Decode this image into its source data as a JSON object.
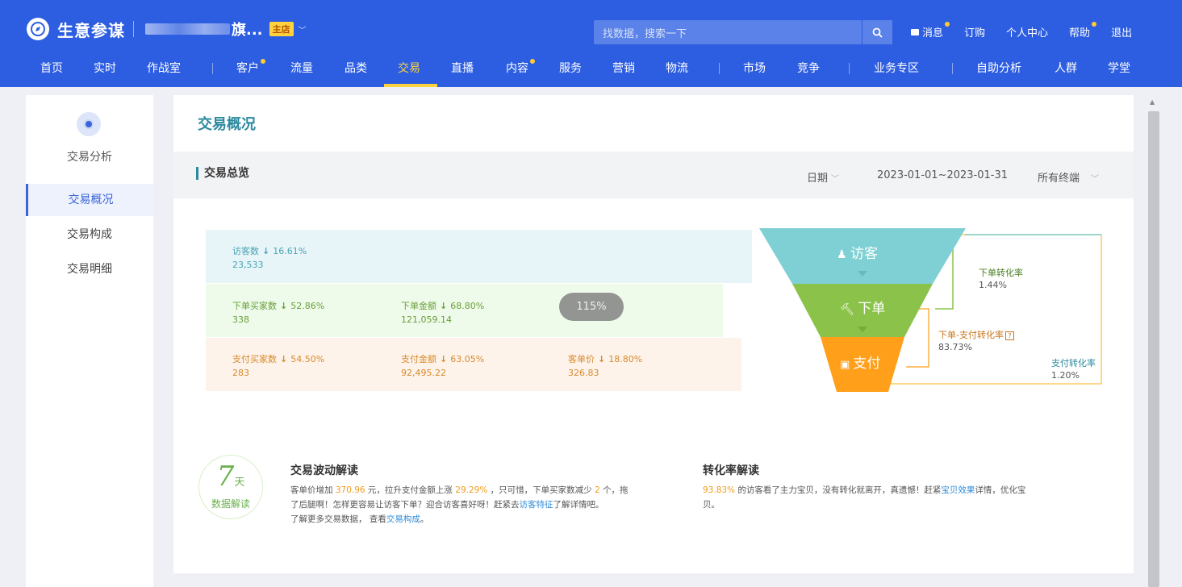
{
  "header": {
    "app_name": "生意参谋",
    "shop_name": "旗...",
    "shop_badge": "主店",
    "search_placeholder": "找数据，搜索一下",
    "links": [
      {
        "label": "消息",
        "dot": true
      },
      {
        "label": "订购",
        "dot": false
      },
      {
        "label": "个人中心",
        "dot": false
      },
      {
        "label": "帮助",
        "dot": true
      },
      {
        "label": "退出",
        "dot": false
      }
    ],
    "nav": [
      {
        "label": "首页",
        "dot": false
      },
      {
        "label": "实时",
        "dot": false
      },
      {
        "label": "作战室",
        "dot": false
      },
      {
        "label": "客户",
        "dot": true
      },
      {
        "label": "流量",
        "dot": false
      },
      {
        "label": "品类",
        "dot": false
      },
      {
        "label": "交易",
        "dot": false,
        "active": true
      },
      {
        "label": "直播",
        "dot": false
      },
      {
        "label": "内容",
        "dot": true
      },
      {
        "label": "服务",
        "dot": false
      },
      {
        "label": "营销",
        "dot": false
      },
      {
        "label": "物流",
        "dot": false
      },
      {
        "label": "市场",
        "dot": false
      },
      {
        "label": "竞争",
        "dot": false
      },
      {
        "label": "业务专区",
        "dot": false
      },
      {
        "label": "自助分析",
        "dot": false
      },
      {
        "label": "人群",
        "dot": false
      },
      {
        "label": "学堂",
        "dot": false
      }
    ]
  },
  "sidebar": {
    "title": "交易分析",
    "items": [
      {
        "label": "交易概况",
        "active": true
      },
      {
        "label": "交易构成",
        "active": false
      },
      {
        "label": "交易明细",
        "active": false
      }
    ]
  },
  "main": {
    "title": "交易概况",
    "section_title": "交易总览",
    "filters": {
      "date_type": "日期",
      "date_range": "2023-01-01~2023-01-31",
      "terminal": "所有终端"
    },
    "metrics": {
      "visitors": {
        "label": "访客数",
        "change": "16.61%",
        "value": "23,533"
      },
      "order_buyers": {
        "label": "下单买家数",
        "change": "52.86%",
        "value": "338"
      },
      "order_amount": {
        "label": "下单金额",
        "change": "68.80%",
        "value": "121,059.14"
      },
      "pay_buyers": {
        "label": "支付买家数",
        "change": "54.50%",
        "value": "283"
      },
      "pay_amount": {
        "label": "支付金额",
        "change": "63.05%",
        "value": "92,495.22"
      },
      "unit_price": {
        "label": "客单价",
        "change": "18.80%",
        "value": "326.83"
      }
    },
    "arrow": "↓",
    "zoom_badge": "115%",
    "funnel": {
      "stages": [
        "访客",
        "下单",
        "支付"
      ],
      "colors": [
        "#7fd0d4",
        "#8bc34a",
        "#ff9f1a"
      ],
      "rates": [
        {
          "label": "下单转化率",
          "value": "1.44%"
        },
        {
          "label": "下单-支付转化率",
          "value": "83.73%"
        },
        {
          "label": "支付转化率",
          "value": "1.20%"
        }
      ]
    },
    "badge": {
      "num": "7",
      "unit": "天",
      "text": "数据解读"
    },
    "insight_trade": {
      "title": "交易波动解读",
      "p1": "客单价增加 ",
      "h1": "370.96",
      "p2": " 元，拉升支付金额上涨 ",
      "h2": "29.29%",
      "p3": " ，只可惜，下单买家数减少 ",
      "h3": "2",
      "p4": " 个，拖",
      "line2a": "了后腿啊！怎样更容易让访客下单？迎合访客喜好呀！赶紧去",
      "link1": "访客特征",
      "line2b": "了解详情吧。",
      "line3a": "了解更多交易数据，  查看",
      "link2": "交易构成",
      "line3b": "。"
    },
    "insight_conv": {
      "title": "转化率解读",
      "h1": "93.83%",
      "p1": " 的访客看了主力宝贝，没有转化就离开，真遗憾！赶紧",
      "link1": "宝贝效果",
      "p2": "详情，优化宝",
      "line2": "贝。"
    }
  }
}
